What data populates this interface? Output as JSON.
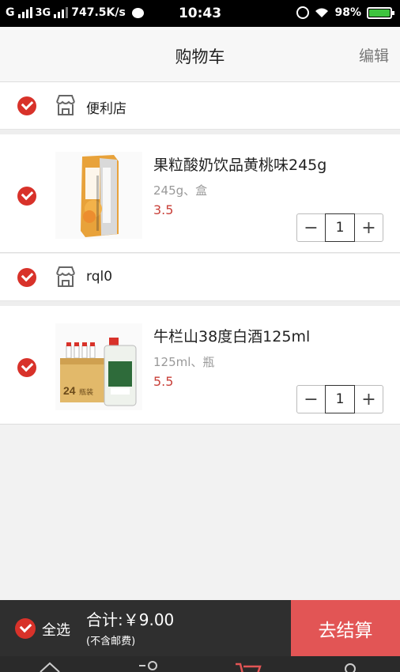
{
  "status_bar": {
    "carrier1": "G",
    "carrier2": "3G",
    "speed": "747.5K/s",
    "time": "10:43",
    "battery": "98%"
  },
  "header": {
    "title": "购物车",
    "edit_label": "编辑"
  },
  "stores": [
    {
      "name": "便利店",
      "item": {
        "name": "果粒酸奶饮品黄桃味245g",
        "spec": "245g、盒",
        "price": "3.5",
        "qty": "1"
      }
    },
    {
      "name": "rql0",
      "item": {
        "name": "牛栏山38度白酒125ml",
        "spec": "125ml、瓶",
        "price": "5.5",
        "qty": "1"
      }
    }
  ],
  "thumb2_text": "24",
  "thumb2_text2": "瓶装",
  "bottom": {
    "select_all": "全选",
    "total": "合计:￥9.00",
    "shipping_note": "(不含邮费)",
    "checkout": "去结算"
  },
  "stepper": {
    "minus": "−",
    "plus": "+"
  },
  "colors": {
    "accent": "#d8322a",
    "checkout": "#e25555",
    "price": "#c9413a",
    "bottom_bar": "#2f2f2f"
  },
  "icons": [
    "signal-icon",
    "message-icon",
    "alarm-icon",
    "wifi-icon",
    "battery-icon",
    "shop-icon",
    "check-icon",
    "home-icon",
    "category-icon",
    "cart-icon",
    "profile-icon"
  ]
}
